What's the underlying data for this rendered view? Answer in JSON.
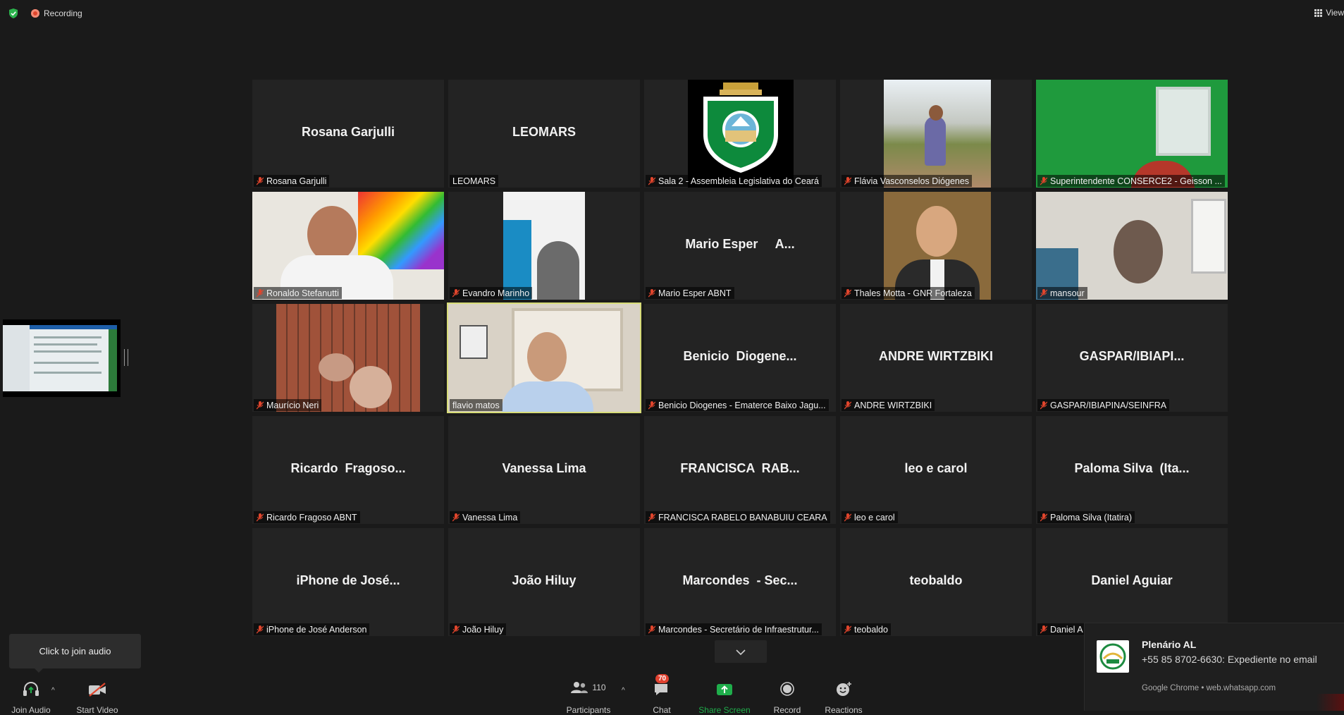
{
  "top": {
    "recording_label": "Recording",
    "view_label": "View"
  },
  "tiles": [
    {
      "big": "Rosana Garjulli",
      "label": "Rosana Garjulli",
      "muted": true
    },
    {
      "big": "LEOMARS",
      "label": "LEOMARS",
      "muted": false
    },
    {
      "big": "",
      "label": "Sala 2 - Assembleia Legislativa do Ceará",
      "muted": true
    },
    {
      "big": "",
      "label": "Flávia Vasconselos Diógenes",
      "muted": true
    },
    {
      "big": "",
      "label": "Superintendente CONSERCE2 - Geisson ...",
      "muted": true
    },
    {
      "big": "",
      "label": "Ronaldo Stefanutti",
      "muted": true
    },
    {
      "big": "",
      "label": "Evandro Marinho",
      "muted": true
    },
    {
      "big": "Mario Esper     A...",
      "label": "Mario Esper     ABNT",
      "muted": true
    },
    {
      "big": "",
      "label": "Thales Motta - GNR Fortaleza",
      "muted": true
    },
    {
      "big": "",
      "label": "mansour",
      "muted": true
    },
    {
      "big": "",
      "label": "Maurício Neri",
      "muted": true
    },
    {
      "big": "",
      "label": "flavio matos",
      "muted": false
    },
    {
      "big": "Benicio  Diogene...",
      "label": "Benicio Diogenes - Ematerce Baixo Jagu...",
      "muted": true
    },
    {
      "big": "ANDRE WIRTZBIKI",
      "label": "ANDRE WIRTZBIKI",
      "muted": true
    },
    {
      "big": "GASPAR/IBIAPI...",
      "label": "GASPAR/IBIAPINA/SEINFRA",
      "muted": true
    },
    {
      "big": "Ricardo  Fragoso...",
      "label": "Ricardo Fragoso ABNT",
      "muted": true
    },
    {
      "big": "Vanessa Lima",
      "label": "Vanessa Lima",
      "muted": true
    },
    {
      "big": "FRANCISCA  RAB...",
      "label": "FRANCISCA RABELO BANABUIU CEARA",
      "muted": true
    },
    {
      "big": "leo e carol",
      "label": "leo e carol",
      "muted": true
    },
    {
      "big": "Paloma Silva  (Ita...",
      "label": "Paloma Silva (Itatira)",
      "muted": true
    },
    {
      "big": "iPhone de José...",
      "label": "iPhone de José Anderson",
      "muted": true
    },
    {
      "big": "João Hiluy",
      "label": "João Hiluy",
      "muted": true
    },
    {
      "big": "Marcondes  - Sec...",
      "label": "Marcondes - Secretário de Infraestrutur...",
      "muted": true
    },
    {
      "big": "teobaldo",
      "label": "teobaldo",
      "muted": true
    },
    {
      "big": "Daniel Aguiar",
      "label": "Daniel A",
      "muted": true
    }
  ],
  "tooltip": "Click to join audio",
  "toolbar": {
    "join_audio": "Join Audio",
    "start_video": "Start Video",
    "participants": "Participants",
    "participants_count": "110",
    "chat": "Chat",
    "chat_badge": "70",
    "share_screen": "Share Screen",
    "record": "Record",
    "reactions": "Reactions"
  },
  "notification": {
    "title": "Plenário AL",
    "body": "+55 85 8702-6630: Expediente no email",
    "source": "Google Chrome • web.whatsapp.com"
  },
  "colors": {
    "active_speaker_border": "#d7dc78",
    "share_green": "#1fae4b",
    "badge_red": "#e0412f",
    "muted_red": "#e0452c"
  }
}
